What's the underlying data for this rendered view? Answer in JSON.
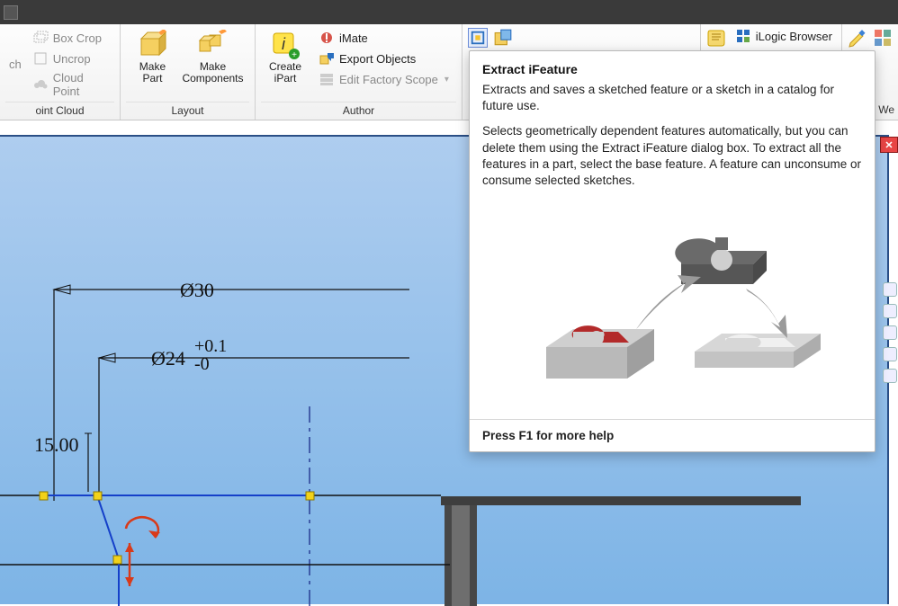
{
  "ribbon": {
    "panels": {
      "pointcloud": {
        "title": "oint Cloud",
        "boxcrop": "Box Crop",
        "uncrop": "Uncrop",
        "cloudpoint": "Cloud Point",
        "ch": "ch"
      },
      "layout": {
        "title": "Layout",
        "makepart1": "Make",
        "makepart2": "Part",
        "makecomp1": "Make",
        "makecomp2": "Components"
      },
      "author": {
        "title": "Author",
        "createipart1": "Create",
        "createipart2": "iPart",
        "imate": "iMate",
        "exportobj": "Export Objects",
        "editfactory": "Edit Factory Scope"
      }
    },
    "ilogic": "iLogic Browser",
    "we": "We"
  },
  "tooltip": {
    "title": "Extract iFeature",
    "p1": "Extracts and saves a sketched feature or a sketch in a catalog for future use.",
    "p2": "Selects geometrically dependent features automatically, but you can delete them using the Extract iFeature dialog box. To extract all the features in a part, select the base feature. A feature can unconsume or consume selected sketches.",
    "footer": "Press F1 for more help"
  },
  "drawing": {
    "d30": "Ø30",
    "d24": "Ø24",
    "tol_up": "+0.1",
    "tol_dn": "-0",
    "d15": "15.00"
  },
  "chart_data": {
    "type": "table",
    "title": "Sketch dimensions (mm)",
    "rows": [
      {
        "label": "Ø30",
        "nominal": 30,
        "upper_tol": null,
        "lower_tol": null
      },
      {
        "label": "Ø24",
        "nominal": 24,
        "upper_tol": 0.1,
        "lower_tol": 0
      },
      {
        "label": "15.00",
        "nominal": 15.0,
        "upper_tol": null,
        "lower_tol": null
      }
    ]
  }
}
